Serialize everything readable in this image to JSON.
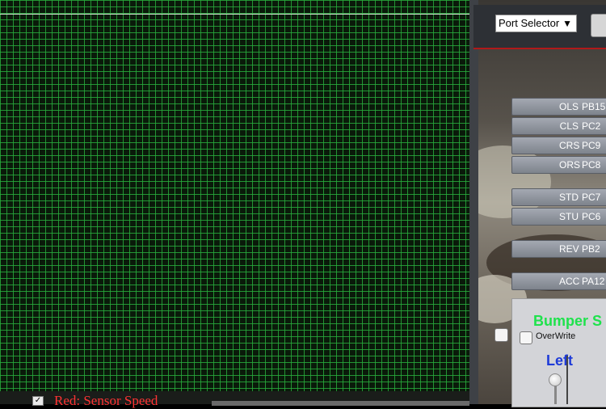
{
  "scope": {
    "legend_label": "Red: Sensor Speed",
    "legend_checked": true,
    "check_mark": "✓"
  },
  "toolbar": {
    "port_selector": "Port Selector",
    "dropdown_arrow": "▼"
  },
  "pins": [
    {
      "label": "OLS",
      "port": "PB15"
    },
    {
      "label": "CLS",
      "port": "PC2"
    },
    {
      "label": "CRS",
      "port": "PC9"
    },
    {
      "label": "ORS",
      "port": "PC8"
    },
    {
      "label": "STD",
      "port": "PC7"
    },
    {
      "label": "STU",
      "port": "PC6"
    },
    {
      "label": "REV",
      "port": "PB2"
    },
    {
      "label": "ACC",
      "port": "PA12"
    }
  ],
  "bumper": {
    "title": "Bumper S",
    "overwrite_label": "OverWrite",
    "overwrite_checked": false,
    "side_label": "Left"
  },
  "colors": {
    "grid": "#28aa3c",
    "legend_text": "#ff3333",
    "bumper_title": "#1ee24c",
    "left_label": "#1e3bd8",
    "toolbar_accent": "#b0191a"
  }
}
